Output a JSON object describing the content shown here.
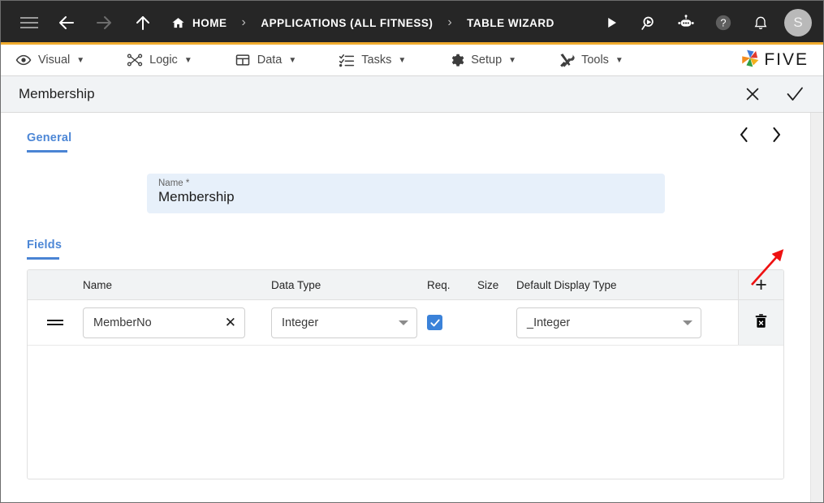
{
  "topbar": {
    "menu_icon": "hamburger-icon",
    "back_icon": "arrow-left-icon",
    "forward_icon": "arrow-right-icon",
    "up_icon": "arrow-up-icon",
    "breadcrumb": [
      {
        "label": "HOME",
        "icon": "home-icon"
      },
      {
        "label": "APPLICATIONS (ALL FITNESS)",
        "icon": ""
      },
      {
        "label": "TABLE WIZARD",
        "icon": ""
      }
    ],
    "separator": "›",
    "actions": [
      {
        "name": "run-icon",
        "title": "Run"
      },
      {
        "name": "debug-icon",
        "title": "Debug"
      },
      {
        "name": "chatbot-icon",
        "title": "Assistant"
      },
      {
        "name": "help-icon",
        "title": "Help"
      },
      {
        "name": "notifications-bell-icon",
        "title": "Notifications"
      }
    ],
    "avatar_initial": "S",
    "accent_color": "#f0ab2e",
    "bar_color": "#262626"
  },
  "menubar": {
    "items": [
      {
        "label": "Visual",
        "icon": "eye-icon",
        "caret": "▼"
      },
      {
        "label": "Logic",
        "icon": "logic-nodes-icon",
        "caret": "▼"
      },
      {
        "label": "Data",
        "icon": "table-grid-icon",
        "caret": "▼"
      },
      {
        "label": "Tasks",
        "icon": "checklist-icon",
        "caret": "▼"
      },
      {
        "label": "Setup",
        "icon": "gear-icon",
        "caret": "▼"
      },
      {
        "label": "Tools",
        "icon": "tools-icon",
        "caret": "▼"
      }
    ],
    "brand": "FIVE"
  },
  "titlebar": {
    "title": "Membership",
    "close_label": "✕",
    "confirm_label": "✓"
  },
  "general": {
    "tab_label": "General",
    "prev_label": "‹",
    "next_label": "›",
    "name_label": "Name *",
    "name_value": "Membership"
  },
  "fields": {
    "tab_label": "Fields",
    "add_label": "+",
    "columns": [
      "",
      "Name",
      "Data Type",
      "Req.",
      "Size",
      "Default Display Type",
      ""
    ],
    "rows": [
      {
        "handle": "drag-handle-icon",
        "name": "MemberNo",
        "clear": "✕",
        "data_type": "Integer",
        "required": true,
        "size": "",
        "default_display_type": "_Integer",
        "delete_icon": "trash-icon"
      }
    ]
  },
  "annotation": {
    "arrow_color": "#ee1111",
    "points_to": "next-record-button"
  }
}
